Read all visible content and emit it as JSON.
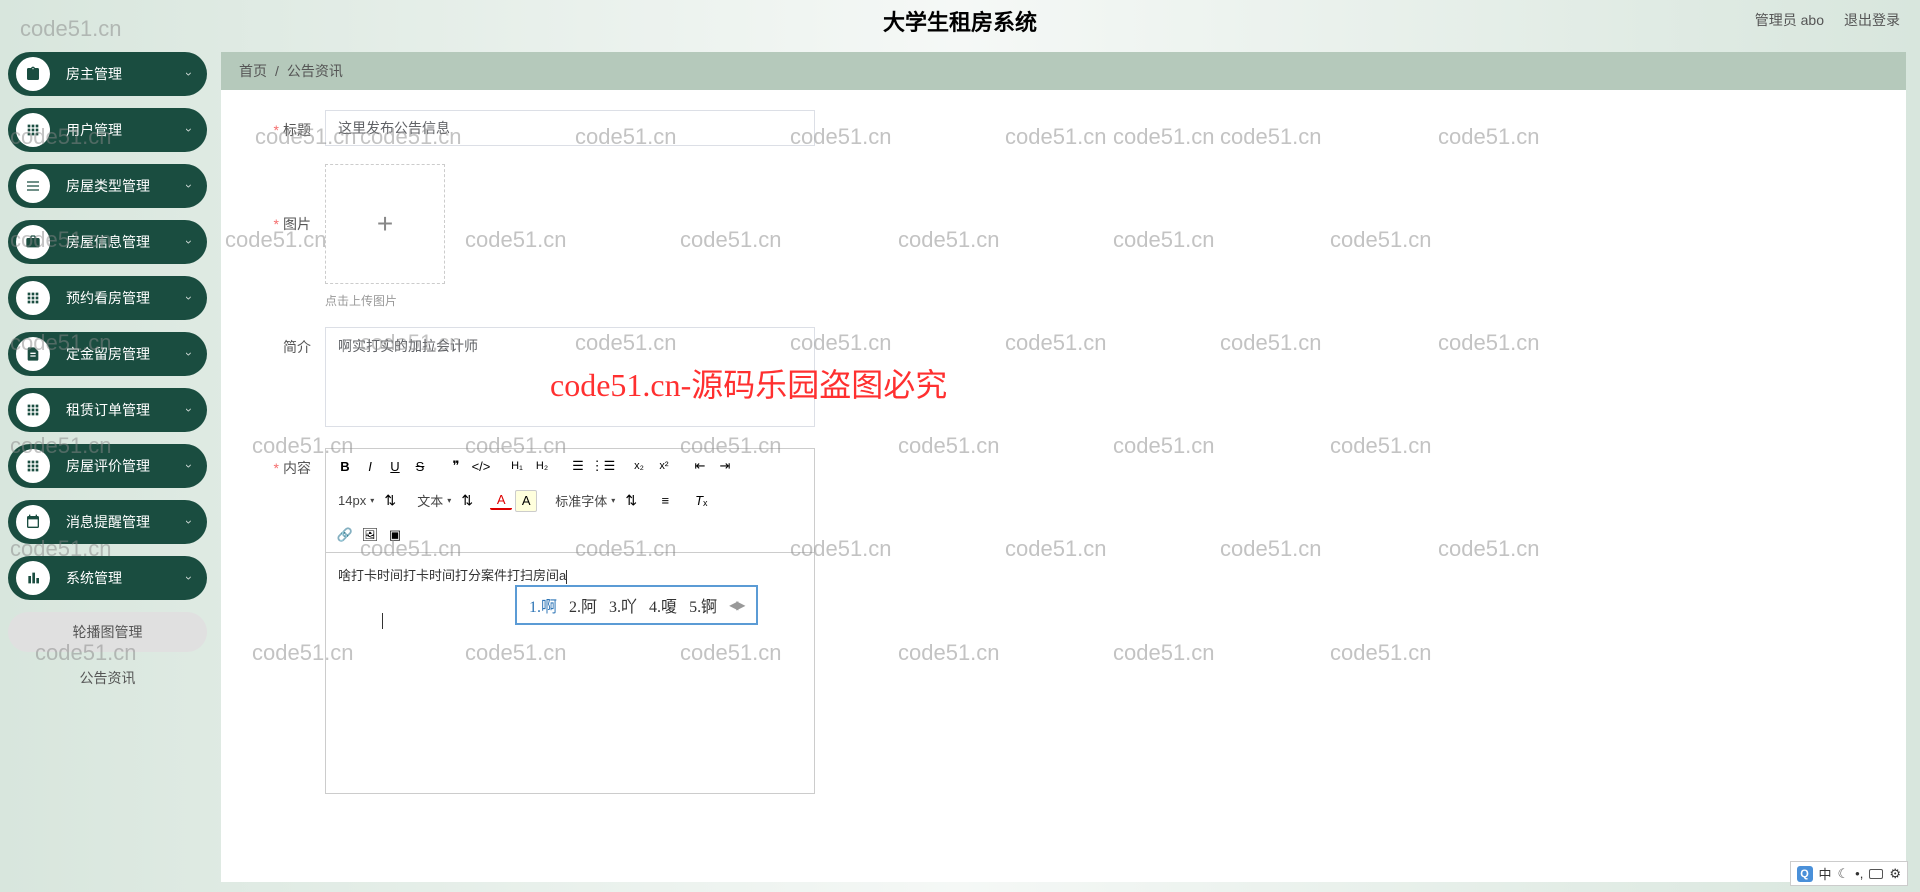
{
  "header": {
    "title": "大学生租房系统",
    "user_role": "管理员",
    "user_name": "abo",
    "logout": "退出登录"
  },
  "sidebar": {
    "items": [
      {
        "label": "房主管理"
      },
      {
        "label": "用户管理"
      },
      {
        "label": "房屋类型管理"
      },
      {
        "label": "房屋信息管理"
      },
      {
        "label": "预约看房管理"
      },
      {
        "label": "定金留房管理"
      },
      {
        "label": "租赁订单管理"
      },
      {
        "label": "房屋评价管理"
      },
      {
        "label": "消息提醒管理"
      },
      {
        "label": "系统管理"
      }
    ],
    "subitems": [
      {
        "label": "轮播图管理"
      },
      {
        "label": "公告资讯"
      }
    ]
  },
  "breadcrumb": {
    "home": "首页",
    "current": "公告资讯"
  },
  "form": {
    "title": {
      "label": "标题",
      "value": "这里发布公告信息"
    },
    "image": {
      "label": "图片",
      "hint": "点击上传图片"
    },
    "intro": {
      "label": "简介",
      "value": "啊实打实的加拉会计师"
    },
    "content": {
      "label": "内容",
      "value": "啥打卡时间打卡时间打分案件打扫房间a"
    }
  },
  "editor": {
    "font_size": "14px",
    "text_type": "文本",
    "font_family": "标准字体"
  },
  "ime": {
    "candidates": [
      "1.啊",
      "2.阿",
      "3.吖",
      "4.嗄",
      "5.锕"
    ]
  },
  "ime_status": {
    "lang": "中"
  },
  "watermark": {
    "text": "code51.cn",
    "center": "code51.cn-源码乐园盗图必究"
  }
}
